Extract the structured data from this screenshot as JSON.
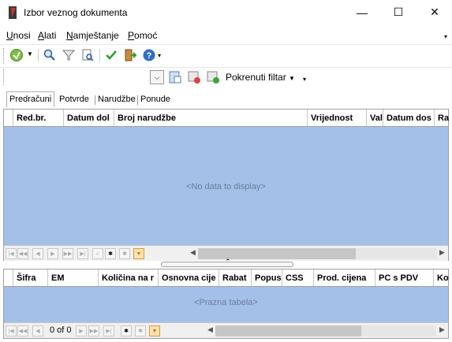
{
  "window": {
    "title": "Izbor veznog dokumenta",
    "minimize": "—",
    "maximize": "☐",
    "close": "✕"
  },
  "menu": {
    "items": [
      {
        "u": "U",
        "rest": "nosi"
      },
      {
        "u": "A",
        "rest": "lati"
      },
      {
        "u": "N",
        "rest": "amještanje"
      },
      {
        "u": "P",
        "rest": "omoć"
      }
    ],
    "overflow": "▾"
  },
  "toolbar2": {
    "filter_label": "Pokrenuti filtar"
  },
  "tabs": [
    "Predračuni",
    "Potvrde",
    "Narudžbe",
    "Ponude"
  ],
  "grid1": {
    "columns": [
      "Red.br.",
      "Datum dol",
      "Broj narudžbe",
      "Vrijednost",
      "Val",
      "Datum dos",
      "Ra"
    ],
    "empty_text": "<No data to display>"
  },
  "grid2": {
    "columns": [
      "Šifra",
      "EM",
      "Količina na r",
      "Osnovna cije",
      "Rabat",
      "Popus",
      "CSS",
      "Prod. cijena",
      "PC s PDV",
      "Ko"
    ],
    "empty_text": "<Prazna tabela>",
    "page_info": "0 of 0"
  },
  "colors": {
    "grid_bg": "#a4c0e8",
    "accent_orange": "#f0a020",
    "check_green": "#2a9d2a"
  }
}
